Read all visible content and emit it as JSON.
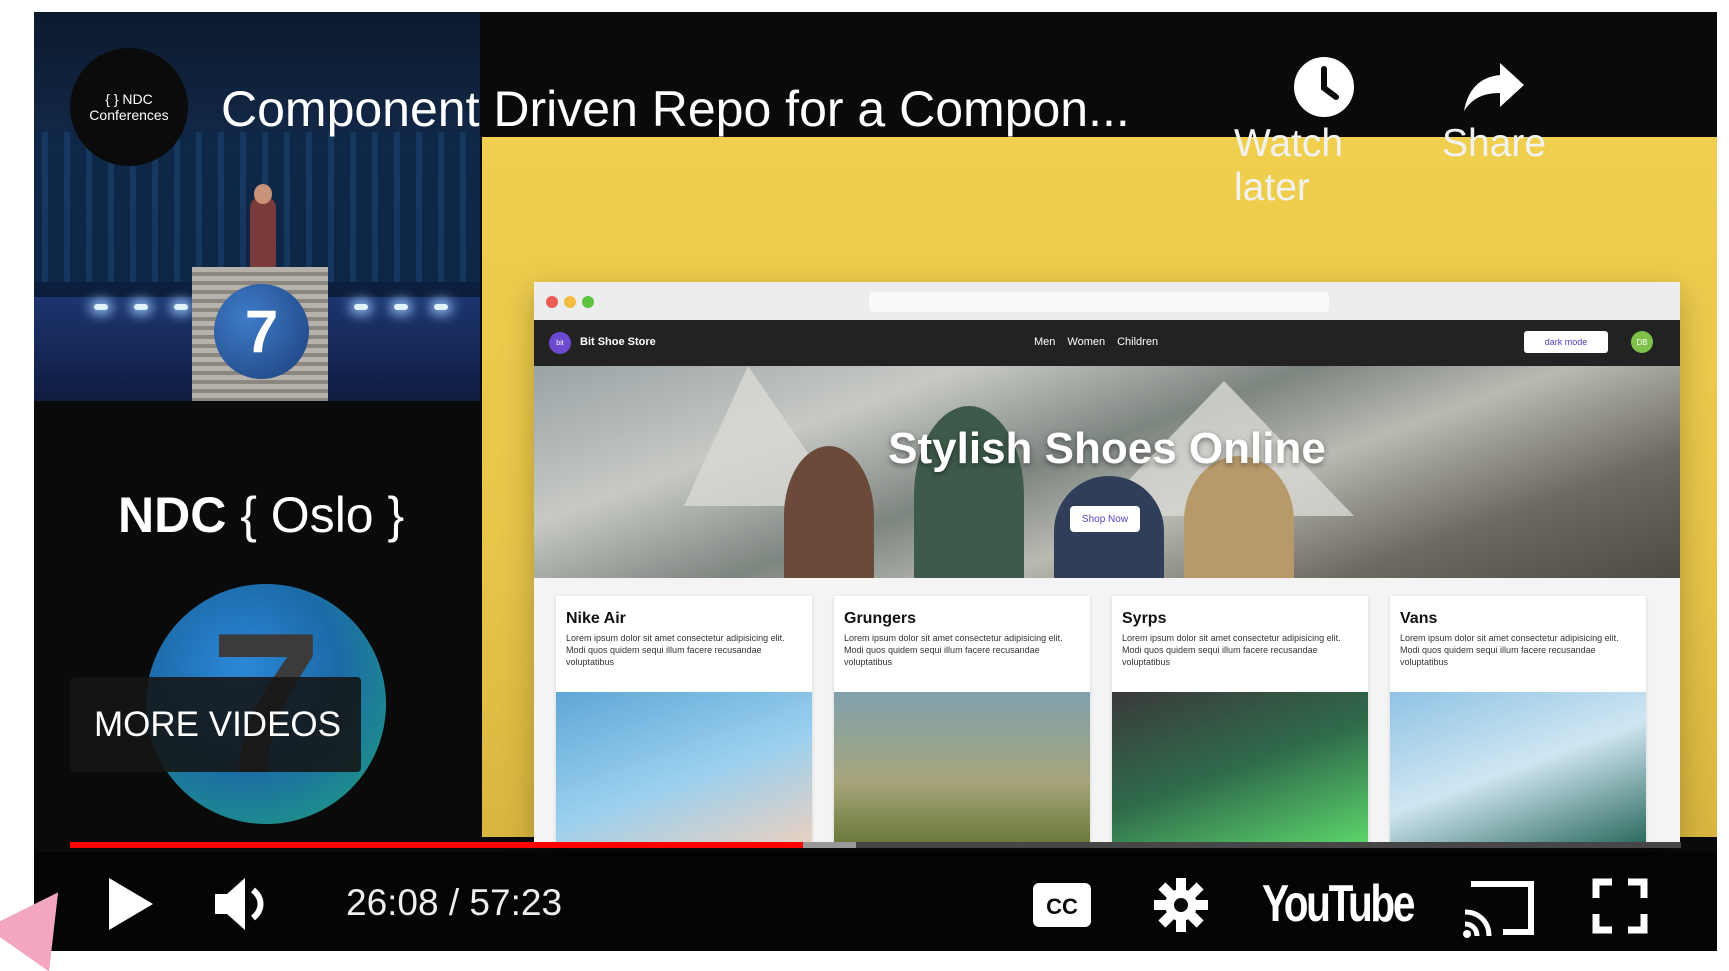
{
  "video": {
    "title": "Component Driven Repo for a Compon...",
    "channel": {
      "line1": "{ } NDC",
      "line2": "Conferences"
    }
  },
  "top_actions": {
    "watch_later_label": "Watch later",
    "share_label": "Share"
  },
  "left_panel": {
    "podium_number": "7",
    "ndc_bold": "NDC",
    "ndc_rest": " { Oslo }",
    "big_number": "7",
    "more_videos_label": "MORE VIDEOS"
  },
  "slide": {
    "store_name": "Bit Shoe Store",
    "logo_text": "bit",
    "nav_links": [
      "Men",
      "Women",
      "Children"
    ],
    "dark_mode_label": "dark mode",
    "avatar_initials": "DB",
    "hero_title": "Stylish Shoes Online",
    "shop_now_label": "Shop Now",
    "products": [
      {
        "name": "Nike Air",
        "desc": "Lorem ipsum dolor sit amet consectetur adipisicing elit. Modi quos quidem sequi illum facere recusandae voluptatibus"
      },
      {
        "name": "Grungers",
        "desc": "Lorem ipsum dolor sit amet consectetur adipisicing elit. Modi quos quidem sequi illum facere recusandae voluptatibus"
      },
      {
        "name": "Syrps",
        "desc": "Lorem ipsum dolor sit amet consectetur adipisicing elit. Modi quos quidem sequi illum facere recusandae voluptatibus"
      },
      {
        "name": "Vans",
        "desc": "Lorem ipsum dolor sit amet consectetur adipisicing elit. Modi quos quidem sequi illum facere recusandae voluptatibus"
      }
    ]
  },
  "controls": {
    "time_display": "26:08 / 57:23",
    "progress_fraction": 0.455,
    "youtube_label": "YouTube",
    "progress_color": "#ff0000"
  },
  "icons": {
    "play": "play-icon",
    "volume": "volume-icon",
    "cc": "closed-captions-icon",
    "settings": "gear-icon",
    "cast": "cast-icon",
    "fullscreen": "fullscreen-icon",
    "watch_later": "clock-icon",
    "share": "share-arrow-icon"
  }
}
